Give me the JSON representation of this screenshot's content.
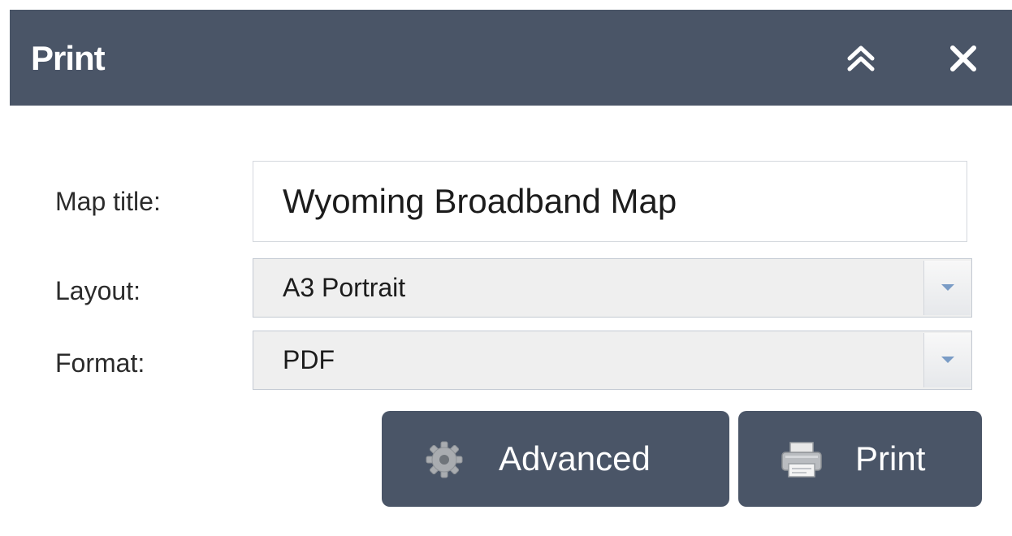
{
  "header": {
    "title": "Print"
  },
  "icons": {
    "collapse": "double-chevron-up-icon",
    "close": "close-icon",
    "advanced": "gear-icon",
    "print": "printer-icon",
    "dropdown": "chevron-down-icon"
  },
  "form": {
    "map_title_label": "Map title:",
    "map_title_value": "Wyoming Broadband Map",
    "layout_label": "Layout:",
    "layout_value": "A3 Portrait",
    "format_label": "Format:",
    "format_value": "PDF"
  },
  "buttons": {
    "advanced_label": "Advanced",
    "print_label": "Print"
  },
  "colors": {
    "header_bg": "#4a5567",
    "button_bg": "#4a5567",
    "select_bg": "#efefef",
    "dropdown_arrow": "#7a9cc6"
  }
}
